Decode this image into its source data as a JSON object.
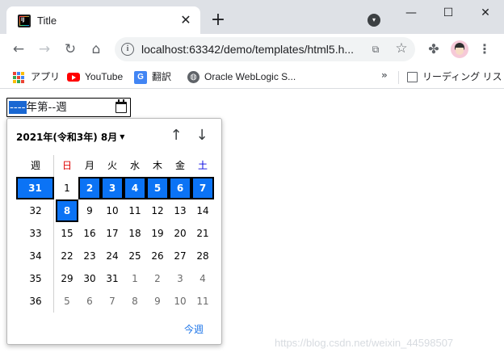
{
  "window": {
    "tab_title": "Title",
    "controls": {
      "minimize": "—",
      "maximize": "☐",
      "close": "✕"
    }
  },
  "toolbar": {
    "url": "localhost:63342/demo/templates/html5.h..."
  },
  "bookmarks": {
    "items": [
      {
        "label": "アプリ",
        "icon": "apps-grid-icon"
      },
      {
        "label": "YouTube",
        "icon": "youtube-icon"
      },
      {
        "label": "翻訳",
        "icon": "translate-icon"
      },
      {
        "label": "Oracle WebLogic S...",
        "icon": "globe-icon"
      }
    ],
    "more": "»",
    "reading_list": "リーディング リスト"
  },
  "week_input": {
    "year_placeholder": "----",
    "year_suffix": "年第",
    "week_placeholder": "--",
    "week_suffix": "週"
  },
  "picker": {
    "month_label": "2021年(令和3年) 8月",
    "today_label": "今週",
    "header": {
      "week": "週",
      "days": [
        "日",
        "月",
        "火",
        "水",
        "木",
        "金",
        "土"
      ]
    },
    "rows": [
      {
        "week": "31",
        "days": [
          "1",
          "2",
          "3",
          "4",
          "5",
          "6",
          "7"
        ]
      },
      {
        "week": "32",
        "days": [
          "8",
          "9",
          "10",
          "11",
          "12",
          "13",
          "14"
        ]
      },
      {
        "week": "33",
        "days": [
          "15",
          "16",
          "17",
          "18",
          "19",
          "20",
          "21"
        ]
      },
      {
        "week": "34",
        "days": [
          "22",
          "23",
          "24",
          "25",
          "26",
          "27",
          "28"
        ]
      },
      {
        "week": "35",
        "days": [
          "29",
          "30",
          "31",
          "1",
          "2",
          "3",
          "4"
        ]
      },
      {
        "week": "36",
        "days": [
          "5",
          "6",
          "7",
          "8",
          "9",
          "10",
          "11"
        ]
      }
    ]
  },
  "colors": {
    "selection": "#0b73f5",
    "sunday_header": "#e00000",
    "saturday_header": "#0000e0",
    "link": "#1a73e8"
  },
  "watermark": "https://blog.csdn.net/weixin_44598507"
}
